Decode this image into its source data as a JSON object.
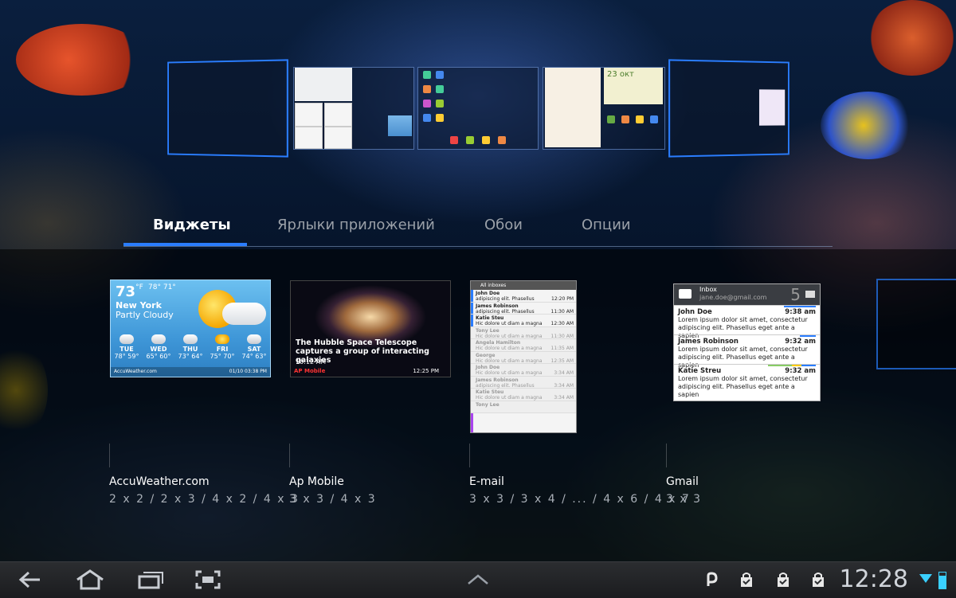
{
  "previews": {
    "date_label": "23 окт"
  },
  "tabs": [
    {
      "label": "Виджеты",
      "active": true
    },
    {
      "label": "Ярлыки приложений",
      "active": false
    },
    {
      "label": "Обои",
      "active": false
    },
    {
      "label": "Опции",
      "active": false
    }
  ],
  "widgets": {
    "weather": {
      "temp": "73",
      "unit": "°F",
      "range": "78° 71°",
      "city": "New York",
      "condition": "Partly Cloudy",
      "days": [
        {
          "d": "TUE",
          "t": "78° 59°"
        },
        {
          "d": "WED",
          "t": "65° 60°"
        },
        {
          "d": "THU",
          "t": "73° 64°"
        },
        {
          "d": "FRI",
          "t": "75° 70°"
        },
        {
          "d": "SAT",
          "t": "74° 63°"
        }
      ],
      "footer_left": "AccuWeather.com",
      "footer_right": "01/10 03:38 PM"
    },
    "apmobile": {
      "caption": "The Hubble Space Telescope captures a group of interacting galaxies",
      "time": "10:12 AM",
      "brand": "AP Mobile",
      "brand_time": "12:25 PM"
    },
    "email": {
      "header": "All inboxes",
      "rows": [
        {
          "from": "John Doe",
          "text": "adipiscing elit. Phasellus",
          "time": "12:20 PM",
          "faded": false
        },
        {
          "from": "James Robinson",
          "text": "adipiscing elit. Phasellus",
          "time": "11:30 AM",
          "faded": false
        },
        {
          "from": "Katie Steu",
          "text": "Hic dolore ut diam a magna",
          "time": "12:30 AM",
          "faded": false
        },
        {
          "from": "Tony Lee",
          "text": "Hic dolore ut diam a magna",
          "time": "11:30 AM",
          "faded": true
        },
        {
          "from": "Angela Hamilton",
          "text": "Hic dolore ut diam a magna",
          "time": "11:35 AM",
          "faded": true
        },
        {
          "from": "George",
          "text": "Hic dolore ut diam a magna",
          "time": "12:35 AM",
          "faded": true
        },
        {
          "from": "John Doe",
          "text": "Hic dolore ut diam a magna",
          "time": "3:34 AM",
          "faded": true
        },
        {
          "from": "James Robinson",
          "text": "adipiscing elit. Phasellus",
          "time": "3:34 AM",
          "faded": true
        },
        {
          "from": "Katie Steu",
          "text": "Hic dolore ut diam a magna",
          "time": "3:34 AM",
          "faded": true
        },
        {
          "from": "Tony Lee",
          "text": "",
          "time": "",
          "faded": true
        }
      ]
    },
    "gmail": {
      "inbox": "Inbox",
      "account": "jane.doe@gmail.com",
      "count": "5",
      "rows": [
        {
          "from": "John Doe",
          "time": "9:38 am",
          "text": "Lorem ipsum dolor sit amet, consectetur adipiscing elit. Phasellus eget ante a sapien"
        },
        {
          "from": "James Robinson",
          "time": "9:32 am",
          "text": "Lorem ipsum dolor sit amet, consectetur adipiscing elit. Phasellus eget ante a sapien"
        },
        {
          "from": "Katie Streu",
          "time": "9:32 am",
          "text": "Lorem ipsum dolor sit amet, consectetur adipiscing elit. Phasellus eget ante a sapien"
        }
      ]
    }
  },
  "labels": [
    {
      "name": "AccuWeather.com",
      "size": "2 x 2 / 2 x 3 / 4 x 2 / 4 x 3"
    },
    {
      "name": "Ap Mobile",
      "size": "3 x 3 / 4 x 3"
    },
    {
      "name": "E-mail",
      "size": "3 x 3 / 3 x 4 / ... / 4 x 6 / 4 x 7"
    },
    {
      "name": "Gmail",
      "size": "3 x 3"
    }
  ],
  "status": {
    "time": "12:28"
  },
  "colors": {
    "accent": "#2a7dff",
    "tab_inactive": "#9aa0a8"
  }
}
